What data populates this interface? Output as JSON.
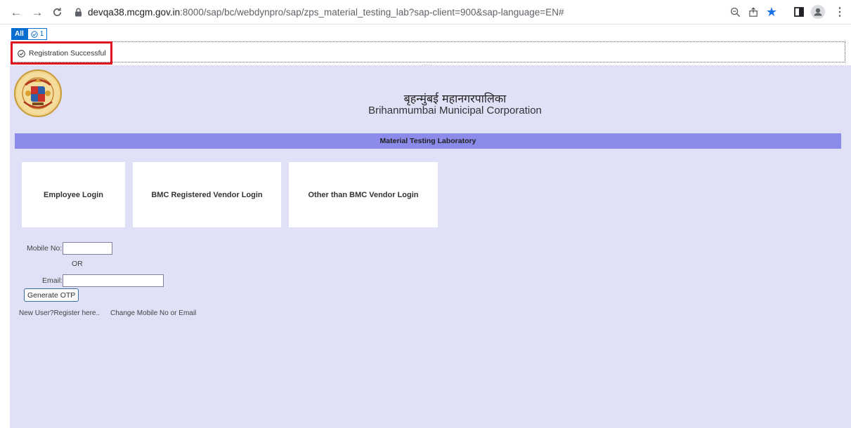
{
  "browser": {
    "url_host": "devqa38.mcgm.gov.in",
    "url_rest": ":8000/sap/bc/webdynpro/sap/zps_material_testing_lab?sap-client=900&sap-language=EN#"
  },
  "messages": {
    "tab_all": "All",
    "tab_success_count": "1",
    "message": "Registration Successful",
    "grip": "....."
  },
  "header": {
    "title_hindi": "बृहन्मुंबई महानगरपालिका",
    "title_english": "Brihanmumbai Municipal Corporation"
  },
  "band_title": "Material Testing Laboratory",
  "tiles": [
    {
      "label": "Employee Login"
    },
    {
      "label": "BMC Registered Vendor Login"
    },
    {
      "label": "Other than BMC Vendor Login"
    }
  ],
  "form": {
    "mobile_label": "Mobile No:",
    "mobile_value": "",
    "or_text": "OR",
    "email_label": "Email:",
    "email_value": "",
    "generate_otp": "Generate OTP"
  },
  "links": {
    "register": "New User?Register here..",
    "change": "Change Mobile No or Email"
  },
  "colors": {
    "app_background": "#e0e0f7",
    "band": "#8b8cea",
    "highlight": "#e0141e",
    "sap_blue": "#0a6ed1"
  }
}
